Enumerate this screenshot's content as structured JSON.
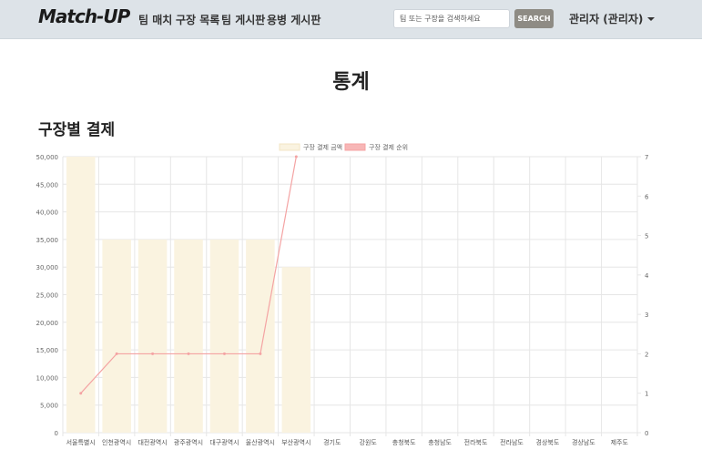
{
  "nav": {
    "brand": "Match-UP",
    "links": [
      "팀 매치",
      "구장 목록",
      "팀 게시판",
      "용병 게시판"
    ],
    "search_placeholder": "팀 또는 구장을 검색하세요",
    "search_button": "SEARCH",
    "user": "관리자 (관리자)"
  },
  "page": {
    "title": "통계",
    "section_title": "구장별 결제"
  },
  "colors": {
    "bar_fill": "#faf3e0",
    "line": "#f4a3a3",
    "grid": "#e6e6e6",
    "navbar": "#dde3e8",
    "search_button": "#8e8b84"
  },
  "chart_data": {
    "type": "bar",
    "categories": [
      "서울특별시",
      "인천광역시",
      "대전광역시",
      "광주광역시",
      "대구광역시",
      "울산광역시",
      "부산광역시",
      "경기도",
      "강원도",
      "충청북도",
      "충청남도",
      "전라북도",
      "전라남도",
      "경상북도",
      "경상남도",
      "제주도"
    ],
    "series": [
      {
        "name": "구장 결제 금액",
        "type": "bar",
        "axis": "left",
        "values": [
          50000,
          35000,
          35000,
          35000,
          35000,
          35000,
          30000,
          0,
          0,
          0,
          0,
          0,
          0,
          0,
          0,
          0
        ]
      },
      {
        "name": "구장 결제 순위",
        "type": "line",
        "axis": "right",
        "values": [
          1,
          2,
          2,
          2,
          2,
          2,
          7,
          null,
          null,
          null,
          null,
          null,
          null,
          null,
          null,
          null
        ]
      }
    ],
    "y_left": {
      "min": 0,
      "max": 50000,
      "step": 5000,
      "ticks": [
        "0",
        "5,000",
        "10,000",
        "15,000",
        "20,000",
        "25,000",
        "30,000",
        "35,000",
        "40,000",
        "45,000",
        "50,000"
      ]
    },
    "y_right": {
      "min": 0,
      "max": 7,
      "step": 1,
      "ticks": [
        "0",
        "1",
        "2",
        "3",
        "4",
        "5",
        "6",
        "7"
      ]
    },
    "grid": true,
    "legend_position": "top"
  }
}
